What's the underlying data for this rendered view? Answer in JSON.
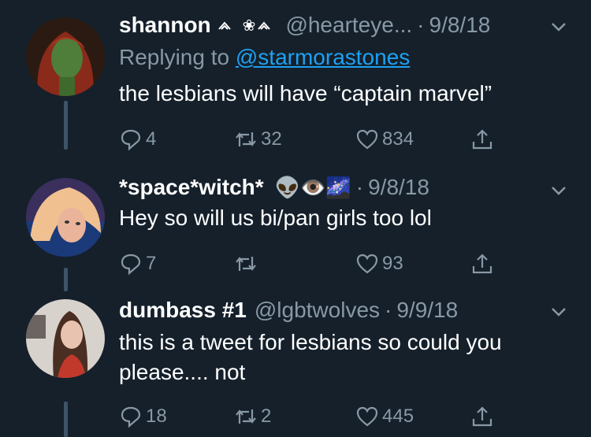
{
  "tweets": [
    {
      "name": "shannon",
      "badges": "❀",
      "handle": "@hearteye...",
      "date": "9/8/18",
      "replying_prefix": "Replying to",
      "replying_to": "@starmorastones",
      "text": "the lesbians will have “captain marvel”",
      "replies": "4",
      "retweets": "32",
      "likes": "834"
    },
    {
      "name": "*space*witch*",
      "badges": "👽👁️🌌",
      "handle": "",
      "date": "9/8/18",
      "text": "Hey so will us bi/pan girls too lol",
      "replies": "7",
      "retweets": "",
      "likes": "93"
    },
    {
      "name": "dumbass #1",
      "handle": "@lgbtwolves",
      "date": "9/9/18",
      "text_line1": "this is a tweet for lesbians so could you",
      "text_line2": "please.... not",
      "replies": "18",
      "retweets": "2",
      "likes": "445"
    }
  ],
  "colors": {
    "background": "#15202b",
    "muted": "#8899a6",
    "link": "#1da1f2",
    "thread": "#3d5466"
  },
  "icons": [
    "reply-icon",
    "retweet-icon",
    "like-icon",
    "share-icon",
    "chevron-down-icon"
  ]
}
